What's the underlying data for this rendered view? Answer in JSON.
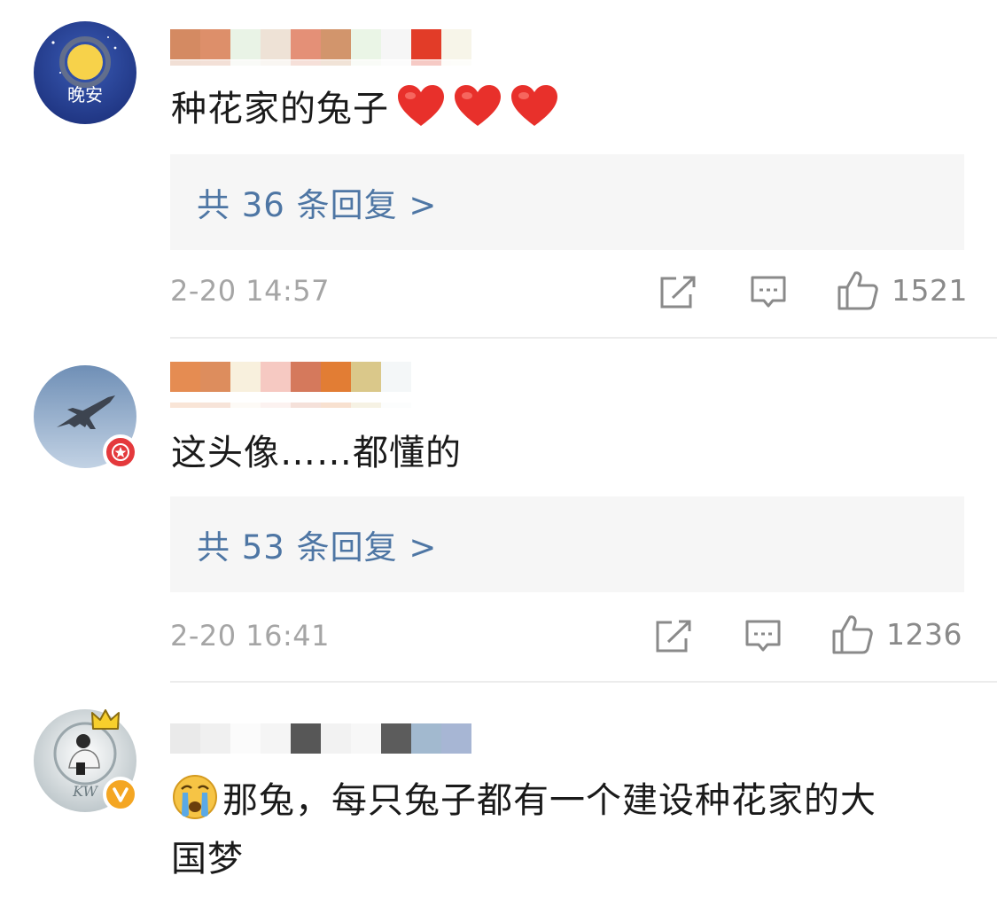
{
  "comments": [
    {
      "avatar_icon": "moon-goodnight-avatar",
      "avatar_text": "晚安",
      "username_hidden": true,
      "text": "种花家的兔子",
      "emojis": [
        "heart-emoji",
        "heart-emoji",
        "heart-emoji"
      ],
      "reply_summary": "共 36 条回复 >",
      "time": "2-20 14:57",
      "likes": "1521"
    },
    {
      "avatar_icon": "fighter-jet-avatar",
      "badge": "red-star-badge",
      "username_hidden": true,
      "text": "这头像……都懂的",
      "reply_summary": "共 53 条回复 >",
      "time": "2-20 16:41",
      "likes": "1236"
    },
    {
      "avatar_icon": "person-photo-avatar",
      "avatar_text": "KW",
      "badge": "verified-v-badge",
      "crown": "crown-icon",
      "username_hidden": true,
      "emoji_prefix": "crying-face-emoji",
      "text_line1": "那兔，每只兔子都有一个建设种花家的大",
      "text_line2": "国梦"
    }
  ],
  "colors": {
    "link": "#4e76a4",
    "meta": "#a5a5a5",
    "reply_bg": "#f6f6f6",
    "heart": "#e8302b"
  }
}
